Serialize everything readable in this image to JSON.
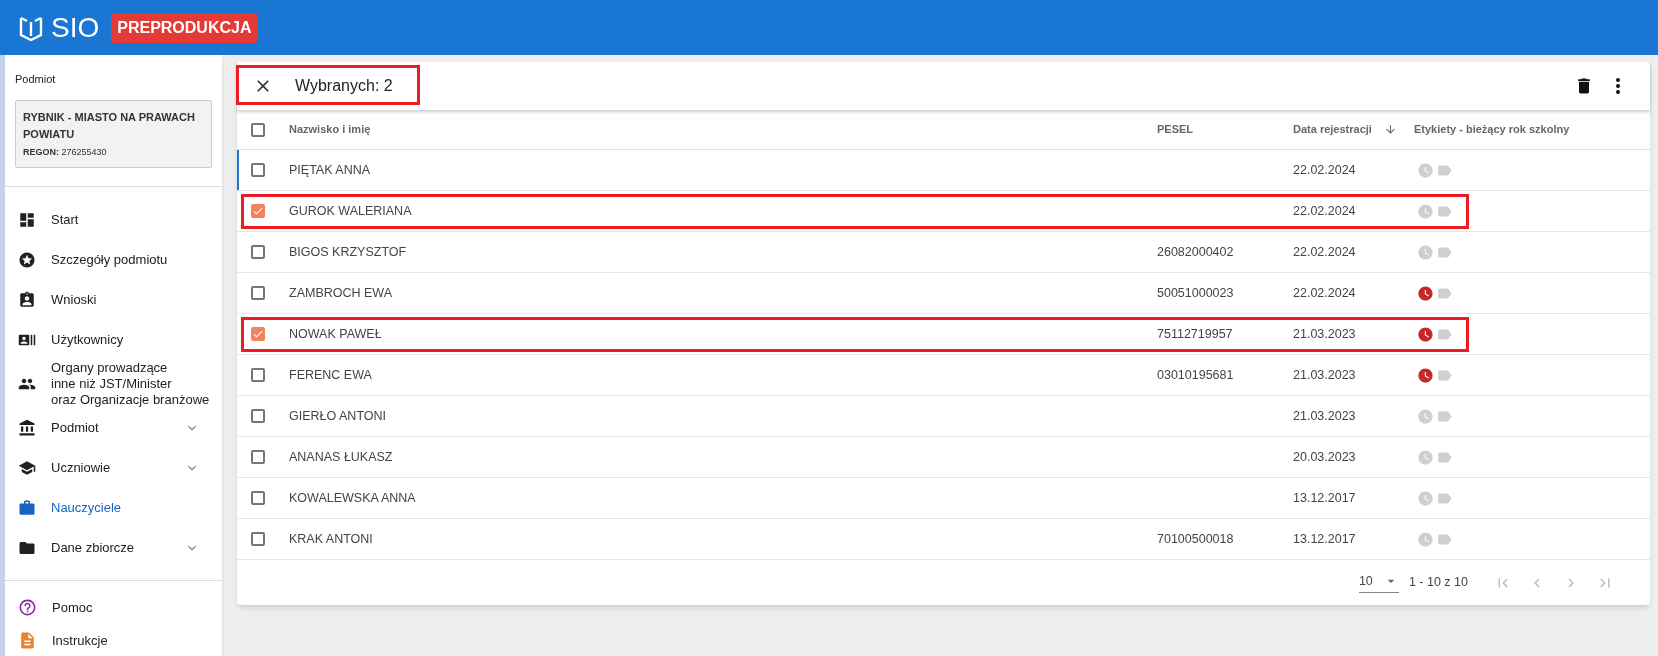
{
  "header": {
    "logo_text": "SIO",
    "environment_badge": "PREPRODUKCJA"
  },
  "sidebar": {
    "entity_label": "Podmiot",
    "entity": {
      "name": "RYBNIK - MIASTO NA PRAWACH POWIATU",
      "regon_label": "REGON:",
      "regon": "276255430"
    },
    "items": [
      {
        "label": "Start",
        "selected": false,
        "expandable": false
      },
      {
        "label": "Szczegóły podmiotu",
        "selected": false,
        "expandable": false
      },
      {
        "label": "Wnioski",
        "selected": false,
        "expandable": false
      },
      {
        "label": "Użytkownicy",
        "selected": false,
        "expandable": false
      },
      {
        "label": "Organy prowadzące\ninne niż JST/Minister\noraz Organizacje branżowe",
        "selected": false,
        "expandable": false
      },
      {
        "label": "Podmiot",
        "selected": false,
        "expandable": true
      },
      {
        "label": "Uczniowie",
        "selected": false,
        "expandable": true
      },
      {
        "label": "Nauczyciele",
        "selected": true,
        "expandable": false
      },
      {
        "label": "Dane zbiorcze",
        "selected": false,
        "expandable": true
      }
    ],
    "bottom_items": [
      {
        "label": "Pomoc"
      },
      {
        "label": "Instrukcje"
      }
    ]
  },
  "selection_bar": {
    "text": "Wybranych: 2",
    "annotated": true
  },
  "table": {
    "all_checked": false,
    "columns": [
      "Nazwisko i imię",
      "PESEL",
      "Data rejestracji",
      "Etykiety - bieżący rok szkolny"
    ],
    "rows": [
      {
        "name": "PIĘTAK ANNA",
        "pesel": "",
        "date": "22.02.2024",
        "clock_alert": false,
        "checked": false,
        "focused": true,
        "annotated": false
      },
      {
        "name": "GUROK WALERIANA",
        "pesel": "",
        "date": "22.02.2024",
        "clock_alert": false,
        "checked": true,
        "focused": false,
        "annotated": true
      },
      {
        "name": "BIGOS KRZYSZTOF",
        "pesel": "26082000402",
        "date": "22.02.2024",
        "clock_alert": false,
        "checked": false,
        "focused": false,
        "annotated": false
      },
      {
        "name": "ZAMBROCH EWA",
        "pesel": "50051000023",
        "date": "22.02.2024",
        "clock_alert": true,
        "checked": false,
        "focused": false,
        "annotated": false
      },
      {
        "name": "NOWAK PAWEŁ",
        "pesel": "75112719957",
        "date": "21.03.2023",
        "clock_alert": true,
        "checked": true,
        "focused": false,
        "annotated": true
      },
      {
        "name": "FERENC EWA",
        "pesel": "03010195681",
        "date": "21.03.2023",
        "clock_alert": true,
        "checked": false,
        "focused": false,
        "annotated": false
      },
      {
        "name": "GIERŁO ANTONI",
        "pesel": "",
        "date": "21.03.2023",
        "clock_alert": false,
        "checked": false,
        "focused": false,
        "annotated": false
      },
      {
        "name": "ANANAS ŁUKASZ",
        "pesel": "",
        "date": "20.03.2023",
        "clock_alert": false,
        "checked": false,
        "focused": false,
        "annotated": false
      },
      {
        "name": "KOWALEWSKA ANNA",
        "pesel": "",
        "date": "13.12.2017",
        "clock_alert": false,
        "checked": false,
        "focused": false,
        "annotated": false
      },
      {
        "name": "KRAK ANTONI",
        "pesel": "70100500018",
        "date": "13.12.2017",
        "clock_alert": false,
        "checked": false,
        "focused": false,
        "annotated": false
      }
    ]
  },
  "pagination": {
    "page_size": "10",
    "range": "1 - 10 z 10"
  }
}
